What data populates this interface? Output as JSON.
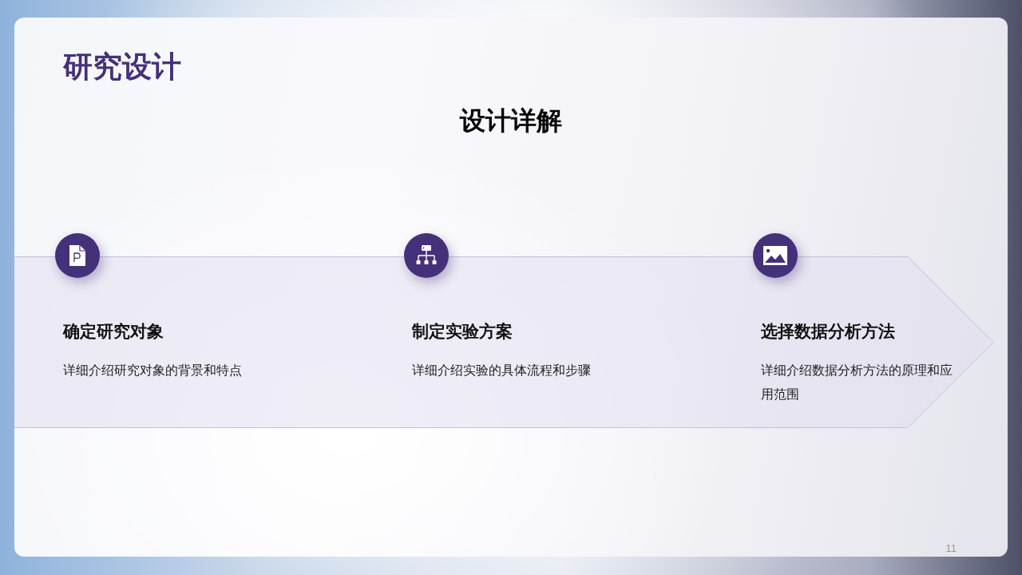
{
  "slide": {
    "title": "研究设计",
    "subtitle": "设计详解",
    "page_number": "11"
  },
  "steps": [
    {
      "kind": "document",
      "title": "确定研究对象",
      "description": "详细介绍研究对象的背景和特点"
    },
    {
      "kind": "hierarchy",
      "title": "制定实验方案",
      "description": "详细介绍实验的具体流程和步骤"
    },
    {
      "kind": "image",
      "title": "选择数据分析方法",
      "description": "详细介绍数据分析方法的原理和应用范围"
    }
  ]
}
